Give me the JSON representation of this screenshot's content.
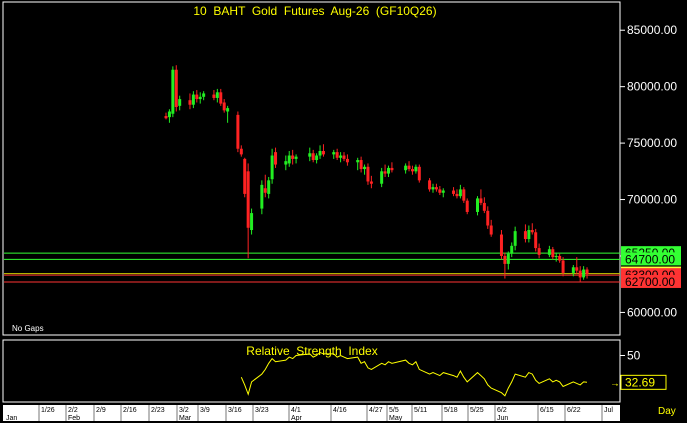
{
  "chart_data": {
    "type": "candlestick",
    "title": "10  BAHT  Gold  Futures  Aug-26  (GF10Q26)",
    "note": "No Gaps",
    "x_unit_label": "Day",
    "y_ticks": [
      "85000.00",
      "80000.00",
      "75000.00",
      "70000.00",
      "65000.00",
      "60000.00"
    ],
    "ylim": [
      58000,
      87500
    ],
    "date_range": [
      "2026-02-23",
      "2026-07-03"
    ],
    "x_axis": {
      "top_labels": [
        "1/26",
        "2/2",
        "2/9",
        "2/16",
        "2/23",
        "3/2",
        "3/9",
        "3/16",
        "3/23",
        "4/1",
        "4/16",
        "4/27",
        "5/5",
        "5/11",
        "5/18",
        "5/25",
        "6/2",
        "6/15",
        "6/22",
        "Jul"
      ],
      "month_labels": [
        "Jan",
        "Feb",
        "Mar",
        "Apr",
        "May",
        "Jun"
      ]
    },
    "horizontal_lines": [
      {
        "value": 65250,
        "label": "65250.00",
        "color": "#33ff33",
        "label_bg": "#33ff33"
      },
      {
        "value": 64700,
        "label": "64700.00",
        "color": "#33ff33",
        "label_bg": "#33ff33"
      },
      {
        "value": 63440,
        "label": "63440.00",
        "color": "#cccc00",
        "label_bg": "#ffff33"
      },
      {
        "value": 63300,
        "label": "63300.00",
        "color": "#ff3333",
        "label_bg": "#ff3333"
      },
      {
        "value": 62700,
        "label": "62700.00",
        "color": "#ff3333",
        "label_bg": "#ff3333"
      }
    ],
    "colors": {
      "up": "#22ee22",
      "down": "#ff2222",
      "rsi_line": "#ffff00",
      "frame": "#ffffff"
    },
    "candles": [
      {
        "date": "2026-02-23",
        "o": 77400,
        "h": 77700,
        "l": 77100,
        "c": 77200
      },
      {
        "date": "2026-02-24",
        "o": 77300,
        "h": 78000,
        "l": 76800,
        "c": 77800
      },
      {
        "date": "2026-02-25",
        "o": 77600,
        "h": 81800,
        "l": 77300,
        "c": 81500
      },
      {
        "date": "2026-02-26",
        "o": 81500,
        "h": 81900,
        "l": 77800,
        "c": 78200
      },
      {
        "date": "2026-02-27",
        "o": 78300,
        "h": 79200,
        "l": 77900,
        "c": 78900
      },
      {
        "date": "2026-03-02",
        "o": 78800,
        "h": 79400,
        "l": 78000,
        "c": 78400
      },
      {
        "date": "2026-03-03",
        "o": 78400,
        "h": 79600,
        "l": 78100,
        "c": 79300
      },
      {
        "date": "2026-03-04",
        "o": 79300,
        "h": 79700,
        "l": 78600,
        "c": 78900
      },
      {
        "date": "2026-03-05",
        "o": 78900,
        "h": 79500,
        "l": 78500,
        "c": 79100
      },
      {
        "date": "2026-03-06",
        "o": 79100,
        "h": 79600,
        "l": 78800,
        "c": 79400
      },
      {
        "date": "2026-03-09",
        "o": 79300,
        "h": 79700,
        "l": 78800,
        "c": 79000
      },
      {
        "date": "2026-03-10",
        "o": 79000,
        "h": 79800,
        "l": 78600,
        "c": 79500
      },
      {
        "date": "2026-03-11",
        "o": 79500,
        "h": 79800,
        "l": 78300,
        "c": 78500
      },
      {
        "date": "2026-03-12",
        "o": 78600,
        "h": 78900,
        "l": 77700,
        "c": 77900
      },
      {
        "date": "2026-03-13",
        "o": 77800,
        "h": 78300,
        "l": 76800,
        "c": 78100
      },
      {
        "date": "2026-03-16",
        "o": 77500,
        "h": 77800,
        "l": 74200,
        "c": 74500
      },
      {
        "date": "2026-03-17",
        "o": 74500,
        "h": 74800,
        "l": 73800,
        "c": 74000
      },
      {
        "date": "2026-03-18",
        "o": 73600,
        "h": 73700,
        "l": 70200,
        "c": 70500
      },
      {
        "date": "2026-03-19",
        "o": 72500,
        "h": 73200,
        "l": 64800,
        "c": 67500
      },
      {
        "date": "2026-03-20",
        "o": 67300,
        "h": 69200,
        "l": 66900,
        "c": 68800
      },
      {
        "date": "2026-03-23",
        "o": 69200,
        "h": 71700,
        "l": 68700,
        "c": 71300
      },
      {
        "date": "2026-03-24",
        "o": 71000,
        "h": 72200,
        "l": 70200,
        "c": 70600
      },
      {
        "date": "2026-03-25",
        "o": 70500,
        "h": 72000,
        "l": 70100,
        "c": 71700
      },
      {
        "date": "2026-03-26",
        "o": 71800,
        "h": 74500,
        "l": 71400,
        "c": 73900
      },
      {
        "date": "2026-03-27",
        "o": 74200,
        "h": 74600,
        "l": 72800,
        "c": 73100
      },
      {
        "date": "2026-03-30",
        "o": 73100,
        "h": 73900,
        "l": 72600,
        "c": 73400
      },
      {
        "date": "2026-03-31",
        "o": 73200,
        "h": 74300,
        "l": 72900,
        "c": 73900
      },
      {
        "date": "2026-04-01",
        "o": 73900,
        "h": 74400,
        "l": 73100,
        "c": 73600
      },
      {
        "date": "2026-04-02",
        "o": 73600,
        "h": 74000,
        "l": 73200,
        "c": 73800
      },
      {
        "date": "2026-04-06",
        "o": 73800,
        "h": 74600,
        "l": 73400,
        "c": 74100
      },
      {
        "date": "2026-04-07",
        "o": 74100,
        "h": 74400,
        "l": 73300,
        "c": 73500
      },
      {
        "date": "2026-04-08",
        "o": 73500,
        "h": 74100,
        "l": 73200,
        "c": 73900
      },
      {
        "date": "2026-04-09",
        "o": 73900,
        "h": 74800,
        "l": 73600,
        "c": 74300
      },
      {
        "date": "2026-04-10",
        "o": 74300,
        "h": 74900,
        "l": 73800,
        "c": 74000
      },
      {
        "date": "2026-04-13",
        "o": 74000,
        "h": 74400,
        "l": 73600,
        "c": 74200
      },
      {
        "date": "2026-04-14",
        "o": 74200,
        "h": 74500,
        "l": 73500,
        "c": 73700
      },
      {
        "date": "2026-04-15",
        "o": 73700,
        "h": 74200,
        "l": 73300,
        "c": 73900
      },
      {
        "date": "2026-04-16",
        "o": 73900,
        "h": 74200,
        "l": 73400,
        "c": 73600
      },
      {
        "date": "2026-04-17",
        "o": 73600,
        "h": 74000,
        "l": 73000,
        "c": 73300
      },
      {
        "date": "2026-04-20",
        "o": 73300,
        "h": 73700,
        "l": 72600,
        "c": 73500
      },
      {
        "date": "2026-04-21",
        "o": 73500,
        "h": 73800,
        "l": 72400,
        "c": 72700
      },
      {
        "date": "2026-04-22",
        "o": 72700,
        "h": 73100,
        "l": 72200,
        "c": 72900
      },
      {
        "date": "2026-04-23",
        "o": 72900,
        "h": 73200,
        "l": 71300,
        "c": 71600
      },
      {
        "date": "2026-04-24",
        "o": 71600,
        "h": 72100,
        "l": 71000,
        "c": 71400
      },
      {
        "date": "2026-04-27",
        "o": 71400,
        "h": 72800,
        "l": 71100,
        "c": 72500
      },
      {
        "date": "2026-04-28",
        "o": 72500,
        "h": 73100,
        "l": 72000,
        "c": 72300
      },
      {
        "date": "2026-04-29",
        "o": 72300,
        "h": 73000,
        "l": 72000,
        "c": 72800
      },
      {
        "date": "2026-04-30",
        "o": 72800,
        "h": 73300,
        "l": 72400,
        "c": 72600
      },
      {
        "date": "2026-05-04",
        "o": 72600,
        "h": 73200,
        "l": 72300,
        "c": 73000
      },
      {
        "date": "2026-05-05",
        "o": 73000,
        "h": 73400,
        "l": 72500,
        "c": 72700
      },
      {
        "date": "2026-05-06",
        "o": 72700,
        "h": 73000,
        "l": 72200,
        "c": 72500
      },
      {
        "date": "2026-05-07",
        "o": 72500,
        "h": 73100,
        "l": 72300,
        "c": 72900
      },
      {
        "date": "2026-05-08",
        "o": 72900,
        "h": 73100,
        "l": 71500,
        "c": 71700
      },
      {
        "date": "2026-05-11",
        "o": 71700,
        "h": 71900,
        "l": 70700,
        "c": 70900
      },
      {
        "date": "2026-05-12",
        "o": 70900,
        "h": 71400,
        "l": 70600,
        "c": 71100
      },
      {
        "date": "2026-05-13",
        "o": 71100,
        "h": 71400,
        "l": 70700,
        "c": 70900
      },
      {
        "date": "2026-05-14",
        "o": 70900,
        "h": 71200,
        "l": 70400,
        "c": 70600
      },
      {
        "date": "2026-05-15",
        "o": 70600,
        "h": 71000,
        "l": 70200,
        "c": 70800
      },
      {
        "date": "2026-05-18",
        "o": 70800,
        "h": 71100,
        "l": 70300,
        "c": 70500
      },
      {
        "date": "2026-05-19",
        "o": 70500,
        "h": 70900,
        "l": 70100,
        "c": 70300
      },
      {
        "date": "2026-05-20",
        "o": 70300,
        "h": 71300,
        "l": 70100,
        "c": 70900
      },
      {
        "date": "2026-05-21",
        "o": 70900,
        "h": 71100,
        "l": 69700,
        "c": 69900
      },
      {
        "date": "2026-05-22",
        "o": 69900,
        "h": 70100,
        "l": 68700,
        "c": 68900
      },
      {
        "date": "2026-05-25",
        "o": 68900,
        "h": 70300,
        "l": 68600,
        "c": 70100
      },
      {
        "date": "2026-05-26",
        "o": 70100,
        "h": 70900,
        "l": 69500,
        "c": 69700
      },
      {
        "date": "2026-05-27",
        "o": 69700,
        "h": 70200,
        "l": 68800,
        "c": 69000
      },
      {
        "date": "2026-05-28",
        "o": 69000,
        "h": 69400,
        "l": 67400,
        "c": 67700
      },
      {
        "date": "2026-05-29",
        "o": 67700,
        "h": 68200,
        "l": 66700,
        "c": 66900
      },
      {
        "date": "2026-06-01",
        "o": 66900,
        "h": 67300,
        "l": 64700,
        "c": 65000
      },
      {
        "date": "2026-06-02",
        "o": 65000,
        "h": 65300,
        "l": 63000,
        "c": 64300
      },
      {
        "date": "2026-06-03",
        "o": 64300,
        "h": 65400,
        "l": 63800,
        "c": 65200
      },
      {
        "date": "2026-06-04",
        "o": 65200,
        "h": 66200,
        "l": 64900,
        "c": 65900
      },
      {
        "date": "2026-06-05",
        "o": 65900,
        "h": 67600,
        "l": 65500,
        "c": 67200
      },
      {
        "date": "2026-06-08",
        "o": 67200,
        "h": 67800,
        "l": 66200,
        "c": 66500
      },
      {
        "date": "2026-06-09",
        "o": 66500,
        "h": 67700,
        "l": 66200,
        "c": 67300
      },
      {
        "date": "2026-06-10",
        "o": 67300,
        "h": 67900,
        "l": 66900,
        "c": 67100
      },
      {
        "date": "2026-06-11",
        "o": 67100,
        "h": 67400,
        "l": 65400,
        "c": 65700
      },
      {
        "date": "2026-06-12",
        "o": 65700,
        "h": 66100,
        "l": 64800,
        "c": 65100
      },
      {
        "date": "2026-06-15",
        "o": 65100,
        "h": 65900,
        "l": 64900,
        "c": 65600
      },
      {
        "date": "2026-06-16",
        "o": 65600,
        "h": 65800,
        "l": 64700,
        "c": 64900
      },
      {
        "date": "2026-06-17",
        "o": 64900,
        "h": 65300,
        "l": 64500,
        "c": 65000
      },
      {
        "date": "2026-06-18",
        "o": 65000,
        "h": 65200,
        "l": 64400,
        "c": 64600
      },
      {
        "date": "2026-06-19",
        "o": 64600,
        "h": 64900,
        "l": 63200,
        "c": 63500
      },
      {
        "date": "2026-06-22",
        "o": 63500,
        "h": 64200,
        "l": 63200,
        "c": 64000
      },
      {
        "date": "2026-06-23",
        "o": 64000,
        "h": 64900,
        "l": 63400,
        "c": 63700
      },
      {
        "date": "2026-06-24",
        "o": 63700,
        "h": 64100,
        "l": 62700,
        "c": 63100
      },
      {
        "date": "2026-06-25",
        "o": 63100,
        "h": 64100,
        "l": 62900,
        "c": 63800
      },
      {
        "date": "2026-06-26",
        "o": 63800,
        "h": 64000,
        "l": 63000,
        "c": 63400
      }
    ],
    "rsi": {
      "title": "Relative  Strength  Index",
      "ytick": "50",
      "ylim": [
        20,
        60
      ],
      "last_value_label": "32.69",
      "points": [
        {
          "date": "2026-03-17",
          "value": 36
        },
        {
          "date": "2026-03-18",
          "value": 31
        },
        {
          "date": "2026-03-19",
          "value": 25
        },
        {
          "date": "2026-03-20",
          "value": 33
        },
        {
          "date": "2026-03-23",
          "value": 38
        },
        {
          "date": "2026-03-24",
          "value": 41
        },
        {
          "date": "2026-03-25",
          "value": 45
        },
        {
          "date": "2026-03-26",
          "value": 48
        },
        {
          "date": "2026-03-27",
          "value": 46
        },
        {
          "date": "2026-03-30",
          "value": 47
        },
        {
          "date": "2026-03-31",
          "value": 49
        },
        {
          "date": "2026-04-01",
          "value": 48
        },
        {
          "date": "2026-04-02",
          "value": 50
        },
        {
          "date": "2026-04-06",
          "value": 51
        },
        {
          "date": "2026-04-07",
          "value": 49
        },
        {
          "date": "2026-04-08",
          "value": 50
        },
        {
          "date": "2026-04-09",
          "value": 52
        },
        {
          "date": "2026-04-10",
          "value": 51
        },
        {
          "date": "2026-04-13",
          "value": 51
        },
        {
          "date": "2026-04-14",
          "value": 49
        },
        {
          "date": "2026-04-15",
          "value": 50
        },
        {
          "date": "2026-04-16",
          "value": 49
        },
        {
          "date": "2026-04-17",
          "value": 48
        },
        {
          "date": "2026-04-20",
          "value": 49
        },
        {
          "date": "2026-04-21",
          "value": 45
        },
        {
          "date": "2026-04-22",
          "value": 46
        },
        {
          "date": "2026-04-23",
          "value": 42
        },
        {
          "date": "2026-04-24",
          "value": 41
        },
        {
          "date": "2026-04-27",
          "value": 45
        },
        {
          "date": "2026-04-28",
          "value": 44
        },
        {
          "date": "2026-04-29",
          "value": 46
        },
        {
          "date": "2026-04-30",
          "value": 45
        },
        {
          "date": "2026-05-04",
          "value": 47
        },
        {
          "date": "2026-05-05",
          "value": 45
        },
        {
          "date": "2026-05-06",
          "value": 44
        },
        {
          "date": "2026-05-07",
          "value": 46
        },
        {
          "date": "2026-05-08",
          "value": 41
        },
        {
          "date": "2026-05-11",
          "value": 38
        },
        {
          "date": "2026-05-12",
          "value": 39
        },
        {
          "date": "2026-05-13",
          "value": 38
        },
        {
          "date": "2026-05-14",
          "value": 37
        },
        {
          "date": "2026-05-15",
          "value": 39
        },
        {
          "date": "2026-05-18",
          "value": 37
        },
        {
          "date": "2026-05-19",
          "value": 36
        },
        {
          "date": "2026-05-20",
          "value": 40
        },
        {
          "date": "2026-05-21",
          "value": 36
        },
        {
          "date": "2026-05-22",
          "value": 33
        },
        {
          "date": "2026-05-25",
          "value": 39
        },
        {
          "date": "2026-05-26",
          "value": 37
        },
        {
          "date": "2026-05-27",
          "value": 35
        },
        {
          "date": "2026-05-28",
          "value": 31
        },
        {
          "date": "2026-05-29",
          "value": 29
        },
        {
          "date": "2026-06-01",
          "value": 26
        },
        {
          "date": "2026-06-02",
          "value": 24
        },
        {
          "date": "2026-06-03",
          "value": 29
        },
        {
          "date": "2026-06-04",
          "value": 33
        },
        {
          "date": "2026-06-05",
          "value": 38
        },
        {
          "date": "2026-06-08",
          "value": 36
        },
        {
          "date": "2026-06-09",
          "value": 39
        },
        {
          "date": "2026-06-10",
          "value": 38
        },
        {
          "date": "2026-06-11",
          "value": 34
        },
        {
          "date": "2026-06-12",
          "value": 32
        },
        {
          "date": "2026-06-15",
          "value": 35
        },
        {
          "date": "2026-06-16",
          "value": 33
        },
        {
          "date": "2026-06-17",
          "value": 34
        },
        {
          "date": "2026-06-18",
          "value": 33
        },
        {
          "date": "2026-06-19",
          "value": 30
        },
        {
          "date": "2026-06-22",
          "value": 33
        },
        {
          "date": "2026-06-23",
          "value": 32
        },
        {
          "date": "2026-06-24",
          "value": 31
        },
        {
          "date": "2026-06-25",
          "value": 33
        },
        {
          "date": "2026-06-26",
          "value": 32.69
        }
      ]
    }
  }
}
